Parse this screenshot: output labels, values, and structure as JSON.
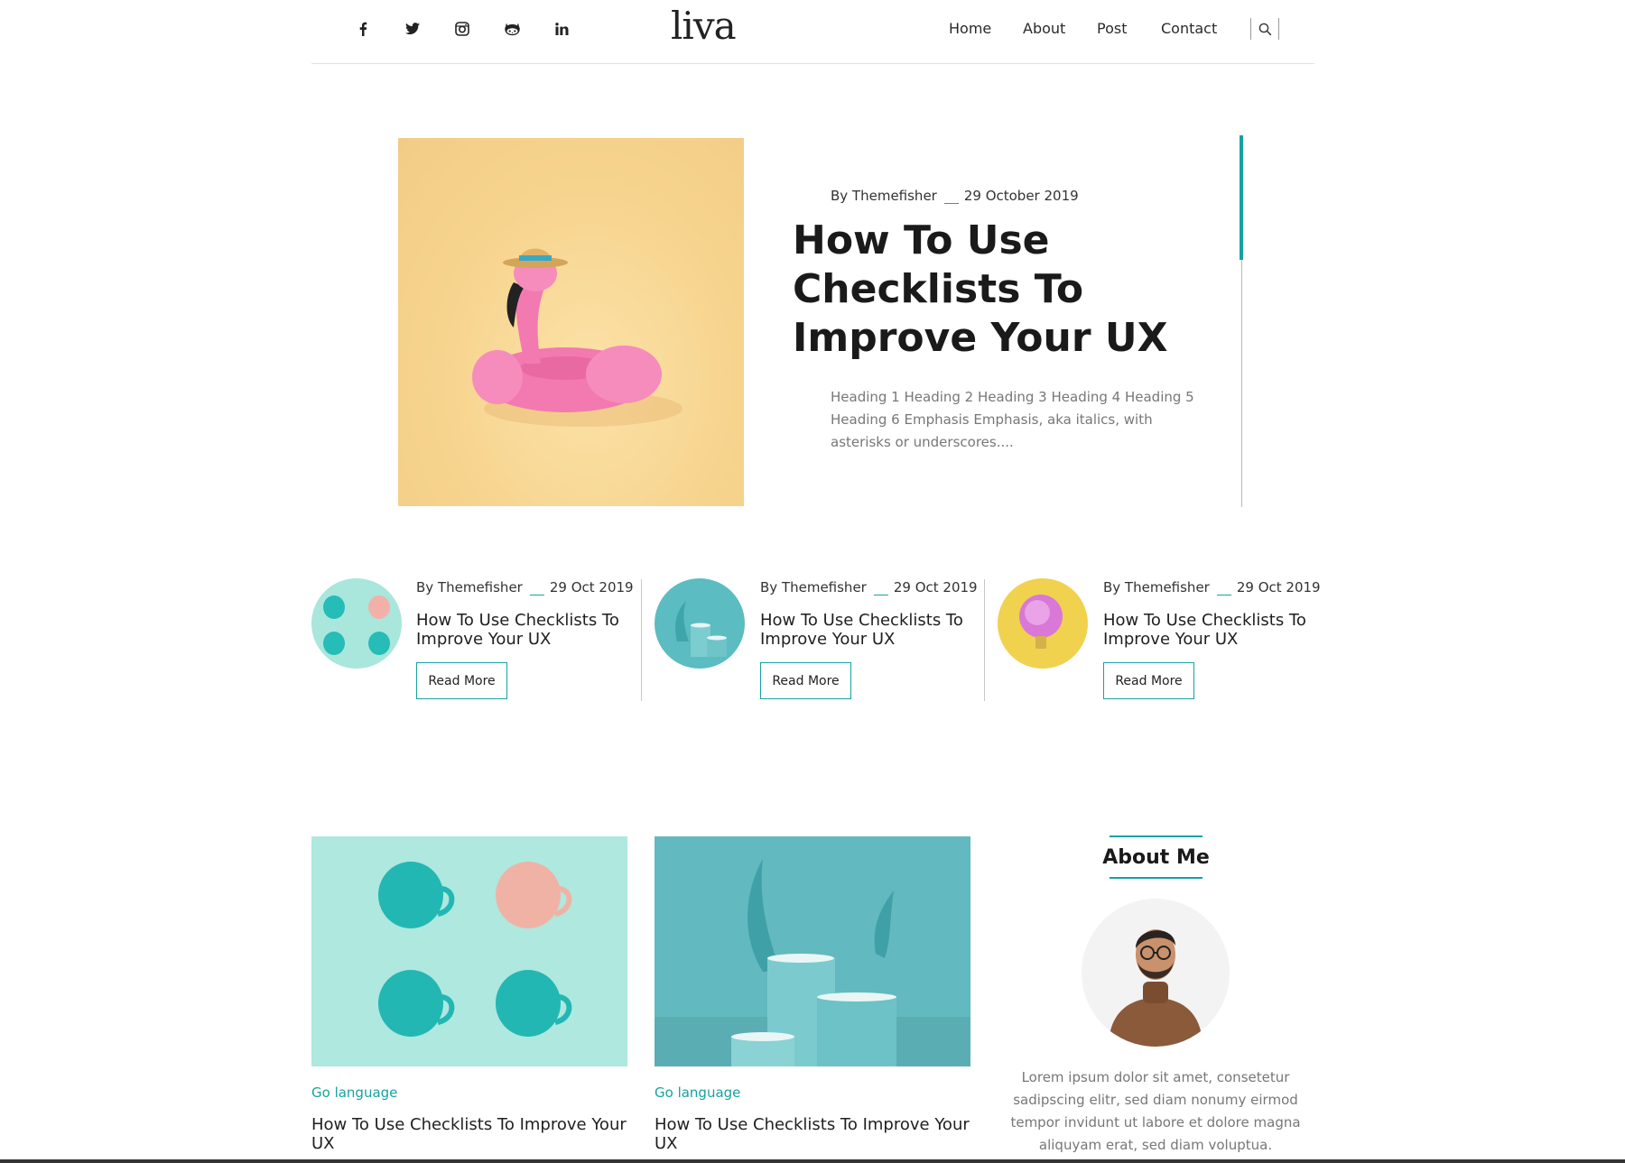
{
  "header": {
    "social": [
      "facebook-icon",
      "twitter-icon",
      "instagram-icon",
      "github-icon",
      "linkedin-icon"
    ],
    "logo": "liva",
    "nav": [
      "Home",
      "About",
      "Post",
      "Contact"
    ],
    "search_icon": "search-icon"
  },
  "hero": {
    "author": "By Themefisher",
    "date": "29 October 2019",
    "title": "How To Use Checklists To Improve Your UX",
    "excerpt": "Heading 1 Heading 2 Heading 3 Heading 4 Heading 5 Heading 6 Emphasis Emphasis, aka italics, with asterisks or underscores...."
  },
  "small_posts": [
    {
      "author": "By Themefisher",
      "date": "29 Oct 2019",
      "title": "How To Use Checklists To Improve Your UX",
      "button": "Read More"
    },
    {
      "author": "By Themefisher",
      "date": "29 Oct 2019",
      "title": "How To Use Checklists To Improve Your UX",
      "button": "Read More"
    },
    {
      "author": "By Themefisher",
      "date": "29 Oct 2019",
      "title": "How To Use Checklists To Improve Your UX",
      "button": "Read More"
    }
  ],
  "grid_posts": [
    {
      "category": "Go language",
      "title": "How To Use Checklists To Improve Your UX"
    },
    {
      "category": "Go language",
      "title": "How To Use Checklists To Improve Your UX"
    }
  ],
  "about": {
    "title": "About Me",
    "text": "Lorem ipsum dolor sit amet, consetetur sadipscing elitr, sed diam nonumy eirmod tempor invidunt ut labore et dolore magna aliquyam erat, sed diam voluptua."
  },
  "colors": {
    "accent": "#17a2a2",
    "text": "#1d1d1d",
    "muted": "#777777"
  }
}
